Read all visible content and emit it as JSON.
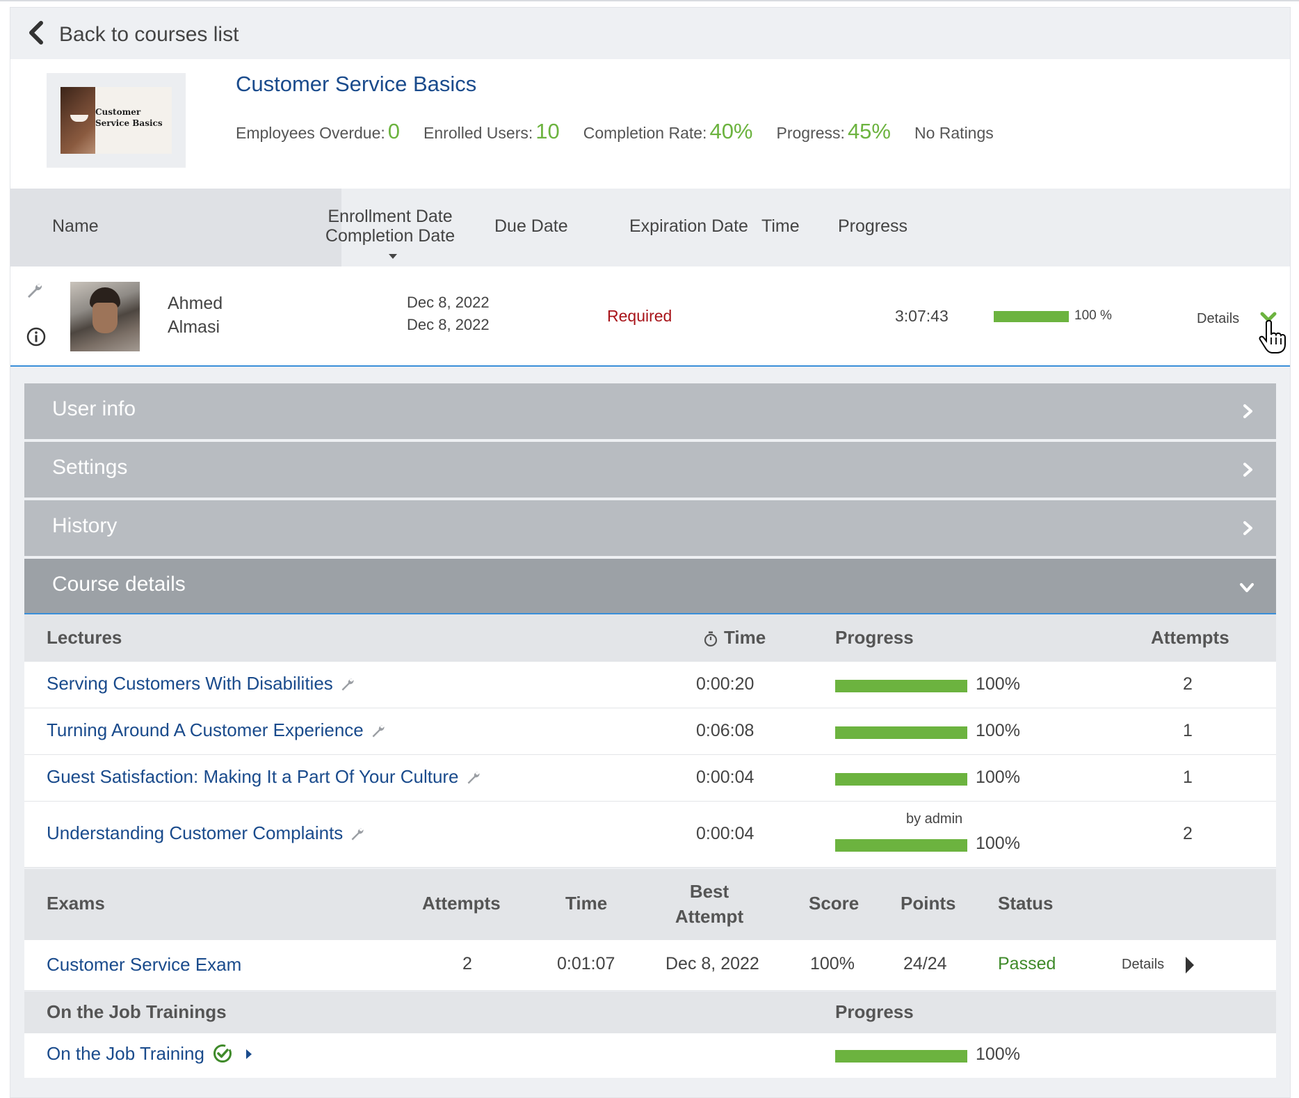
{
  "nav": {
    "back_label": "Back to courses list"
  },
  "course": {
    "thumbnail_text": "Customer Service Basics",
    "title": "Customer Service Basics",
    "stats": [
      {
        "label": "Employees Overdue:",
        "value": "0"
      },
      {
        "label": "Enrolled Users:",
        "value": "10"
      },
      {
        "label": "Completion Rate:",
        "value": "40%"
      },
      {
        "label": "Progress:",
        "value": "45%"
      }
    ],
    "ratings": "No Ratings"
  },
  "columns": {
    "name": "Name",
    "enrollment_date": "Enrollment Date",
    "completion_date": "Completion Date",
    "due_date": "Due Date",
    "expiration_date": "Expiration Date",
    "time": "Time",
    "progress": "Progress"
  },
  "user": {
    "first_name": "Ahmed",
    "last_name": "Almasi",
    "enrollment_date": "Dec 8, 2022",
    "completion_date": "Dec 8, 2022",
    "due": "Required",
    "time": "3:07:43",
    "progress_label": "100 %",
    "progress_fraction": 1.0,
    "details_label": "Details"
  },
  "accordion": {
    "user_info": "User info",
    "settings": "Settings",
    "history": "History",
    "course_details": "Course details"
  },
  "lectures": {
    "header": {
      "name": "Lectures",
      "time": "Time",
      "progress": "Progress",
      "attempts": "Attempts"
    },
    "rows": [
      {
        "name": "Serving Customers With Disabilities",
        "time": "0:00:20",
        "progress": "100%",
        "attempts": "2",
        "note": ""
      },
      {
        "name": "Turning Around A Customer Experience",
        "time": "0:06:08",
        "progress": "100%",
        "attempts": "1",
        "note": ""
      },
      {
        "name": "Guest Satisfaction: Making It a Part Of Your Culture",
        "time": "0:00:04",
        "progress": "100%",
        "attempts": "1",
        "note": ""
      },
      {
        "name": "Understanding Customer Complaints",
        "time": "0:00:04",
        "progress": "100%",
        "attempts": "2",
        "note": "by admin"
      }
    ]
  },
  "exams": {
    "header": {
      "name": "Exams",
      "attempts": "Attempts",
      "time": "Time",
      "best_line1": "Best",
      "best_line2": "Attempt",
      "score": "Score",
      "points": "Points",
      "status": "Status"
    },
    "rows": [
      {
        "name": "Customer Service Exam",
        "attempts": "2",
        "time": "0:01:07",
        "best": "Dec 8, 2022",
        "score": "100%",
        "points": "24/24",
        "status": "Passed",
        "details": "Details"
      }
    ]
  },
  "ojt": {
    "header": {
      "name": "On the Job Trainings",
      "progress": "Progress"
    },
    "rows": [
      {
        "name": "On the Job Training",
        "progress": "100%"
      }
    ]
  },
  "colors": {
    "accent_green": "#6cb33f",
    "link_blue": "#1a4b8c",
    "required_red": "#a8141a",
    "focus_blue": "#3a8fd9"
  }
}
